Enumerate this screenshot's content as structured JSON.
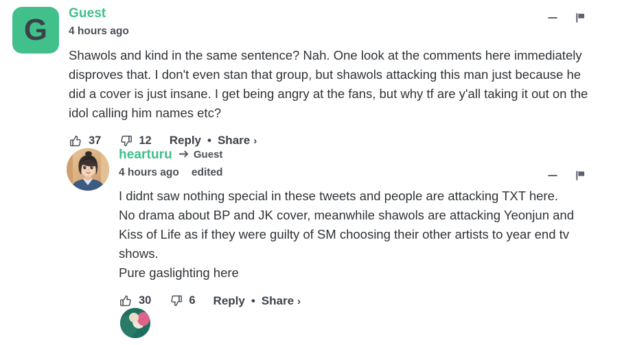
{
  "theme": {
    "accent_green": "#3ec08a",
    "avatar_green": "#42c08c",
    "text_dark": "#2f3337",
    "meta_gray": "#4b5059",
    "background": "#ffffff"
  },
  "comments": [
    {
      "id": "comment-root",
      "avatar_type": "letter",
      "avatar_letter": "G",
      "author": "Guest",
      "timestamp": "4 hours ago",
      "edited_label": "",
      "reply_to": "",
      "text": "Shawols and kind in the same sentence? Nah. One look at the comments here immediately disproves that. I don't even stan that group, but shawols attacking this man just because he did a cover is just insane. I get being angry at the fans, but why tf are y'all taking it out on the idol calling him names etc?",
      "upvotes": "37",
      "downvotes": "12",
      "reply_label": "Reply",
      "separator": "•",
      "share_label": "Share",
      "share_chevron": "›",
      "collapse_icon": "minus-icon",
      "flag_icon": "flag-icon"
    },
    {
      "id": "comment-reply",
      "avatar_type": "photo",
      "avatar_letter": "",
      "author": "hearturu",
      "timestamp": "4 hours ago",
      "edited_label": "edited",
      "reply_to": "Guest",
      "text": "I didnt saw nothing special in these tweets and people are attacking TXT here.\nNo drama about BP and JK cover, meanwhile shawols are attacking Yeonjun and Kiss of Life as if they were guilty of SM choosing their other artists to year end tv shows.\nPure gaslighting here",
      "upvotes": "30",
      "downvotes": "6",
      "reply_label": "Reply",
      "separator": "•",
      "share_label": "Share",
      "share_chevron": "›",
      "collapse_icon": "minus-icon",
      "flag_icon": "flag-icon"
    }
  ],
  "icons": {
    "thumbs_up": "thumbs-up-icon",
    "thumbs_down": "thumbs-down-icon",
    "reply_arrow": "reply-arrow-icon",
    "minus": "minus-icon",
    "flag": "flag-icon"
  }
}
